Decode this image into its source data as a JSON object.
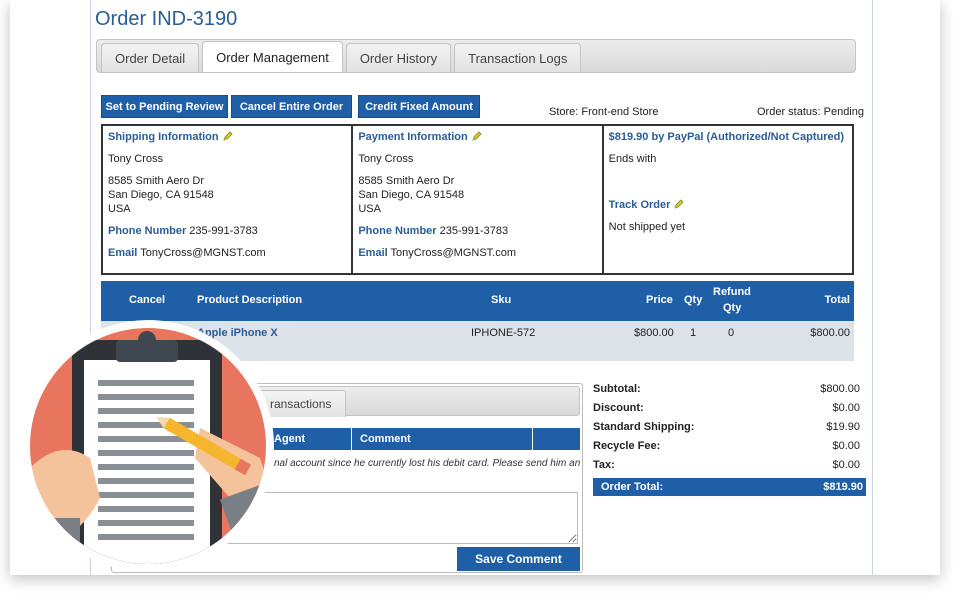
{
  "page": {
    "title": "Order IND-3190"
  },
  "tabs": [
    {
      "label": "Order Detail",
      "active": false
    },
    {
      "label": "Order Management",
      "active": true
    },
    {
      "label": "Order History",
      "active": false
    },
    {
      "label": "Transaction Logs",
      "active": false
    }
  ],
  "actions": {
    "pending_review": "Set to Pending Review",
    "cancel_order": "Cancel Entire Order",
    "credit_fixed": "Credit Fixed Amount"
  },
  "store": "Store: Front-end Store",
  "order_status": "Order status: Pending",
  "shipping": {
    "heading": "Shipping Information",
    "name": "Tony Cross",
    "address1": "8585 Smith Aero Dr",
    "address2": "San Diego, CA 91548",
    "country": "USA",
    "phone_label": "Phone Number",
    "phone": "235-991-3783",
    "email_label": "Email",
    "email": "TonyCross@MGNST.com"
  },
  "payment": {
    "heading": "Payment Information",
    "name": "Tony Cross",
    "address1": "8585 Smith Aero Dr",
    "address2": "San Diego, CA 91548",
    "country": "USA",
    "phone_label": "Phone Number",
    "phone": "235-991-3783",
    "email_label": "Email",
    "email": "TonyCross@MGNST.com"
  },
  "paypal": {
    "heading": "$819.90 by PayPal (Authorized/Not Captured)",
    "ends_with": "Ends with",
    "track_label": "Track Order",
    "track_status": "Not shipped yet"
  },
  "items_table": {
    "headers": {
      "cancel": "Cancel",
      "description": "Product Description",
      "sku": "Sku",
      "price": "Price",
      "qty": "Qty",
      "refund_line1": "Refund",
      "refund_line2": "Qty",
      "total": "Total"
    },
    "rows": [
      {
        "description": "Apple iPhone X",
        "sku": "IPHONE-572",
        "price": "$800.00",
        "qty": "1",
        "refund_qty": "0",
        "total": "$800.00"
      }
    ]
  },
  "comments": {
    "tab_label": "ransactions",
    "col_agent": "Agent",
    "col_comment": "Comment",
    "note": "nal account since he currently lost his debit card. Please send him an",
    "save_label": "Save Comment"
  },
  "totals": [
    {
      "label": "Subtotal:",
      "value": "$800.00"
    },
    {
      "label": "Discount:",
      "value": "$0.00"
    },
    {
      "label": "Standard Shipping:",
      "value": "$19.90"
    },
    {
      "label": "Recycle Fee:",
      "value": "$0.00"
    },
    {
      "label": "Tax:",
      "value": "$0.00"
    }
  ],
  "order_total": {
    "label": "Order Total:",
    "value": "$819.90"
  },
  "colors": {
    "accent": "#1f5fa8",
    "title": "#2a5d95",
    "illustration_bg": "#e8765f"
  },
  "icons": [
    "pencil-icon",
    "clipboard-illustration"
  ]
}
